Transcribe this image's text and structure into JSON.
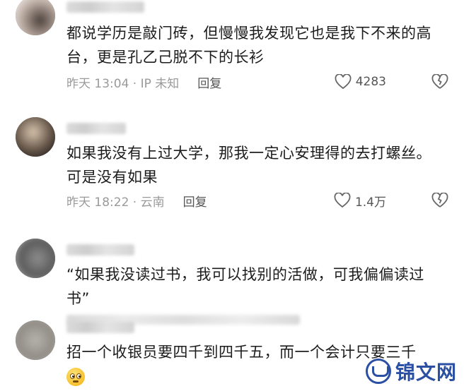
{
  "comments": [
    {
      "text": "都说学历是敲门砖，但慢慢我发现它也是我下不来的高台，更是孔乙己脱不下的长衫",
      "time": "昨天 13:04 · IP 未知",
      "reply_label": "回复",
      "like_count": "4283"
    },
    {
      "text": "如果我没有上过大学，那我一定心安理得的去打螺丝。可是没有如果",
      "time": "昨天 18:22 · 云南",
      "reply_label": "回复",
      "like_count": "1.4万"
    },
    {
      "text": "“如果我没读过书，我可以找别的活做，可我偏偏读过书”"
    },
    {
      "text": "招一个收银员要四千到四千五，而一个会计只要三千"
    }
  ],
  "icons": {
    "like": "heart-icon",
    "dislike": "broken-heart-icon",
    "emoji": "flushed-face-emoji"
  },
  "watermark": {
    "text": "锦文网"
  },
  "colors": {
    "meta": "#9a9a9a",
    "watermark": "#2a4fa3"
  }
}
